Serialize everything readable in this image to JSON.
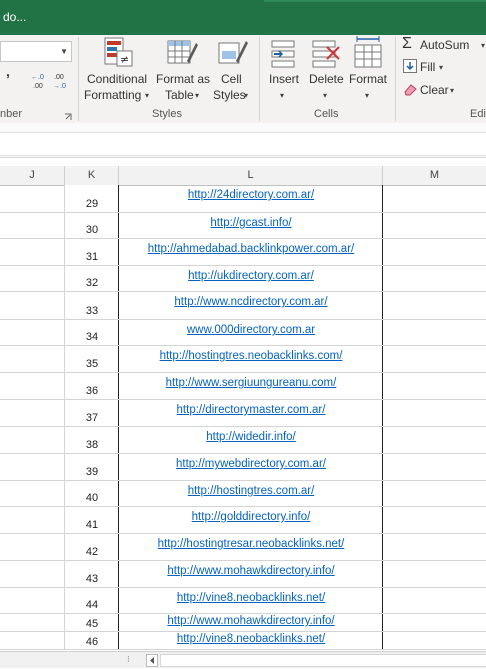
{
  "window": {
    "title": "do..."
  },
  "ribbon": {
    "group_left_label": "nber",
    "comma_glyph": "ʼ",
    "increase_decimal": "←.0\n.00",
    "decrease_decimal": ".00\n→.0",
    "styles": {
      "group_label": "Styles",
      "conditional_formatting": [
        "Conditional",
        "Formatting"
      ],
      "format_as_table": [
        "Format as",
        "Table"
      ],
      "cell_styles": [
        "Cell",
        "Styles"
      ]
    },
    "cells": {
      "group_label": "Cells",
      "insert": "Insert",
      "delete": "Delete",
      "format": "Format"
    },
    "editing": {
      "group_label": "Edi",
      "autosum": "AutoSum",
      "fill": "Fill",
      "clear": "Clear"
    }
  },
  "columns": [
    "J",
    "K",
    "L",
    "M"
  ],
  "rows": [
    {
      "num": "29",
      "url": "http://24directory.com.ar/"
    },
    {
      "num": "30",
      "url": "http://gcast.info/"
    },
    {
      "num": "31",
      "url": "http://ahmedabad.backlinkpower.com.ar/"
    },
    {
      "num": "32",
      "url": "http://ukdirectory.com.ar/"
    },
    {
      "num": "33",
      "url": "http://www.ncdirectory.com.ar/"
    },
    {
      "num": "34",
      "url": "www.000directory.com.ar"
    },
    {
      "num": "35",
      "url": "http://hostingtres.neobacklinks.com/"
    },
    {
      "num": "36",
      "url": "http://www.sergiuungureanu.com/"
    },
    {
      "num": "37",
      "url": "http://directorymaster.com.ar/"
    },
    {
      "num": "38",
      "url": "http://widedir.info/"
    },
    {
      "num": "39",
      "url": "http://mywebdirectory.com.ar/"
    },
    {
      "num": "40",
      "url": "http://hostingtres.com.ar/"
    },
    {
      "num": "41",
      "url": "http://golddirectory.info/"
    },
    {
      "num": "42",
      "url": "http://hostingtresar.neobacklinks.net/"
    },
    {
      "num": "43",
      "url": "http://www.mohawkdirectory.info/"
    },
    {
      "num": "44",
      "url": "http://vine8.neobacklinks.net/"
    },
    {
      "num": "45",
      "url": "http://www.mohawkdirectory.info/"
    },
    {
      "num": "46",
      "url": "http://vine8.neobacklinks.net/"
    }
  ],
  "colors": {
    "excel_green": "#217346",
    "hyperlink": "#0563c1"
  }
}
